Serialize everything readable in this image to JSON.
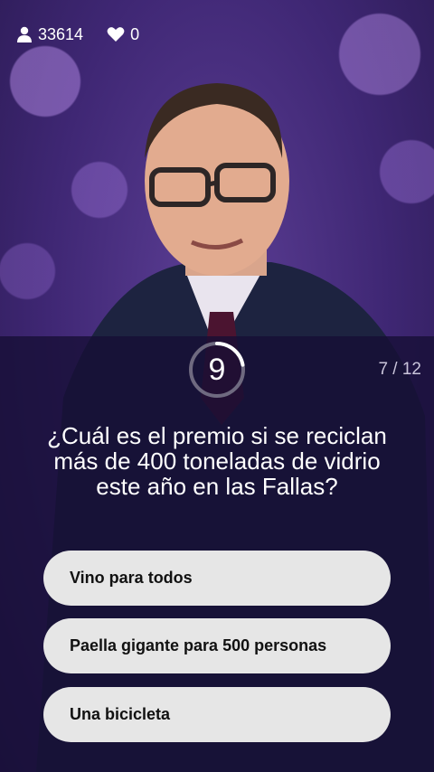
{
  "stats": {
    "viewers": "33614",
    "likes": "0"
  },
  "quiz": {
    "timer": "9",
    "timer_fraction_remaining": 0.22,
    "progress": "7 / 12",
    "question": "¿Cuál es el premio si se reciclan más de 400 toneladas de vidrio este año en las Fallas?",
    "answers": [
      {
        "label": "Vino para todos"
      },
      {
        "label": "Paella gigante para 500 personas"
      },
      {
        "label": "Una bicicleta"
      }
    ]
  },
  "colors": {
    "overlay": "#160e34",
    "answer_bg": "#e6e6e6",
    "timer_ring": "#6f6a80",
    "timer_progress": "#ffffff"
  },
  "icons": {
    "viewers": "person-icon",
    "likes": "heart-icon"
  }
}
